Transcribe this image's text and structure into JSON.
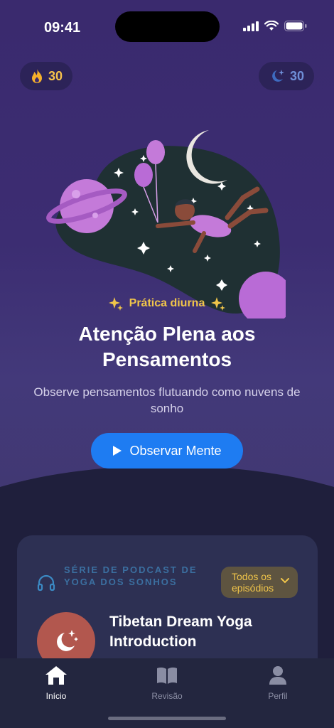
{
  "status_bar": {
    "time": "09:41"
  },
  "counters": {
    "streak": "30",
    "sleep": "30"
  },
  "hero": {
    "eyebrow": "Prática diurna",
    "title": "Atenção Plena aos Pensamentos",
    "subtitle": "Observe pensamentos flutuando como nuvens de sonho",
    "cta_label": "Observar Mente"
  },
  "podcast": {
    "section_label": "SÉRIE DE PODCAST DE YOGA DOS SONHOS",
    "episodes_button": "Todos os episódios",
    "episode_title": "Tibetan Dream Yoga Introduction"
  },
  "tabs": [
    {
      "label": "Início",
      "icon": "home-icon",
      "active": true
    },
    {
      "label": "Revisão",
      "icon": "book-icon",
      "active": false
    },
    {
      "label": "Perfil",
      "icon": "person-icon",
      "active": false
    }
  ],
  "colors": {
    "accent_blue": "#1e7cf2",
    "gold": "#f0c54a",
    "hero_purple": "#3c2d72",
    "background": "#1f1f3c"
  }
}
